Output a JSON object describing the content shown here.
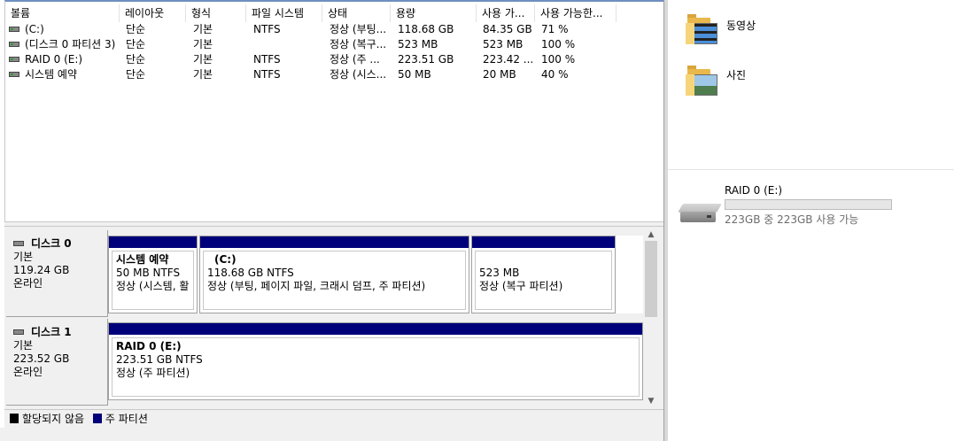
{
  "volume_list": {
    "columns": [
      "볼륨",
      "레이아웃",
      "형식",
      "파일 시스템",
      "상태",
      "용량",
      "사용 가...",
      "사용 가능한..."
    ],
    "rows": [
      {
        "volume": "(C:)",
        "layout": "단순",
        "type": "기본",
        "fs": "NTFS",
        "status": "정상 (부팅...",
        "capacity": "118.68 GB",
        "free": "84.35 GB",
        "pct": "71 %"
      },
      {
        "volume": "(디스크 0 파티션 3)",
        "layout": "단순",
        "type": "기본",
        "fs": "",
        "status": "정상 (복구...",
        "capacity": "523 MB",
        "free": "523 MB",
        "pct": "100 %"
      },
      {
        "volume": "RAID 0 (E:)",
        "layout": "단순",
        "type": "기본",
        "fs": "NTFS",
        "status": "정상 (주 ...",
        "capacity": "223.51 GB",
        "free": "223.42 ...",
        "pct": "100 %"
      },
      {
        "volume": "시스템 예약",
        "layout": "단순",
        "type": "기본",
        "fs": "NTFS",
        "status": "정상 (시스...",
        "capacity": "50 MB",
        "free": "20 MB",
        "pct": "40 %"
      }
    ]
  },
  "disks": [
    {
      "name": "디스크 0",
      "type": "기본",
      "size": "119.24 GB",
      "state": "온라인",
      "partitions": [
        {
          "name": "시스템 예약",
          "size": "50 MB NTFS",
          "status": "정상 (시스템, 활"
        },
        {
          "name": "(C:)",
          "size": "118.68 GB NTFS",
          "status": "정상 (부팅, 페이지 파일, 크래시 덤프, 주 파티션)"
        },
        {
          "name": "",
          "size": "523 MB",
          "status": "정상 (복구 파티션)"
        }
      ]
    },
    {
      "name": "디스크 1",
      "type": "기본",
      "size": "223.52 GB",
      "state": "온라인",
      "partitions": [
        {
          "name": "RAID 0  (E:)",
          "size": "223.51 GB NTFS",
          "status": "정상 (주 파티션)"
        }
      ]
    }
  ],
  "legend": {
    "unallocated": "할당되지 않음",
    "primary": "주 파티션",
    "unallocated_color": "#000000",
    "primary_color": "#00007a"
  },
  "explorer": {
    "folders": [
      {
        "label": "동영상",
        "icon": "video-folder-icon"
      },
      {
        "label": "사진",
        "icon": "pictures-folder-icon"
      }
    ],
    "drive": {
      "name": "RAID 0 (E:)",
      "free_text": "223GB 중 223GB 사용 가능",
      "used_fraction": 0.0,
      "bar_color": "#26a0da"
    }
  }
}
